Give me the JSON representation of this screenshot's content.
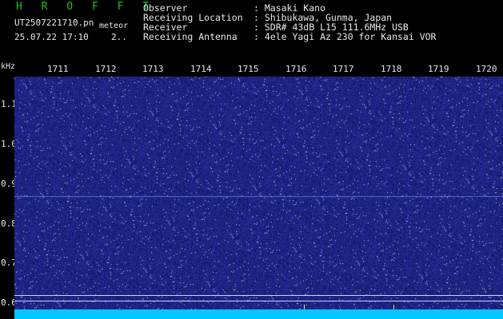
{
  "header": {
    "logo": "H R O F F T",
    "filename": "UT2507221710.pn",
    "tag": "meteor",
    "timestamp": "25.07.22 17:10",
    "flag": "2.."
  },
  "info": [
    {
      "key": "Observer",
      "value": ": Masaki Kano"
    },
    {
      "key": "Receiving Location",
      "value": ": Shibukawa, Gunma, Japan"
    },
    {
      "key": "Receiver",
      "value": ": SDR# 43dB L15 111.6MHz USB"
    },
    {
      "key": "Receiving Antenna",
      "value": ": 4ele Yagi Az 230 for Kansai VOR"
    }
  ],
  "scale": {
    "unit": "kHz",
    "time_ticks": [
      "1711",
      "1712",
      "1713",
      "1714",
      "1715",
      "1716",
      "1717",
      "1718",
      "1719",
      "1720"
    ],
    "freq_ticks": [
      "1.1",
      "1.0",
      "0.9",
      "0.8",
      "0.7",
      "0.6"
    ]
  },
  "colors": {
    "background": "#1e2280",
    "trace": "#00c8ff",
    "logo": "#18c418"
  }
}
